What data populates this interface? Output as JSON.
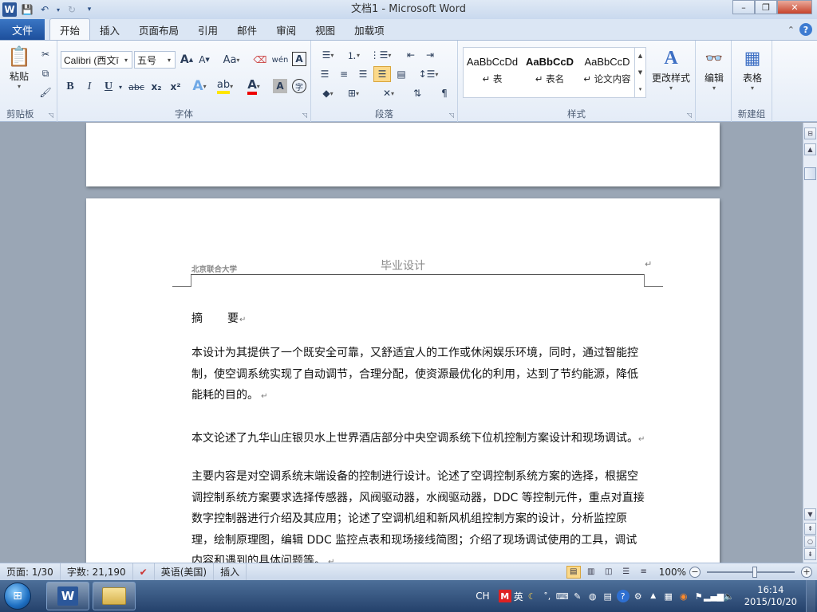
{
  "window": {
    "title": "文档1 - Microsoft Word",
    "minimize": "–",
    "restore": "❐",
    "close": "✕"
  },
  "tabs": {
    "file": "文件",
    "items": [
      "开始",
      "插入",
      "页面布局",
      "引用",
      "邮件",
      "审阅",
      "视图",
      "加载项"
    ],
    "active_index": 0
  },
  "ribbon": {
    "clipboard": {
      "label": "剪贴板",
      "paste": "粘贴"
    },
    "font": {
      "label": "字体",
      "font_name": "Calibri (西文ī",
      "font_size": "五号",
      "bold": "B",
      "italic": "I",
      "underline": "U",
      "strike": "abc",
      "subscript": "x₂",
      "superscript": "x²",
      "grow": "A",
      "shrink": "A",
      "change_case": "Aa"
    },
    "paragraph": {
      "label": "段落"
    },
    "styles": {
      "label": "样式",
      "items": [
        {
          "sample": "AaBbCcDd",
          "name": "↵ 表"
        },
        {
          "sample": "AaBbCcD",
          "name": "↵ 表名"
        },
        {
          "sample": "AaBbCcD",
          "name": "↵ 论文内容"
        }
      ],
      "change_styles": "更改样式"
    },
    "editing": {
      "label": "编辑"
    },
    "new_group": {
      "label": "新建组",
      "table": "表格"
    }
  },
  "document": {
    "header_left": "北京联合大学",
    "header_center": "毕业设计",
    "abstract_title": "摘　　要",
    "paragraphs": [
      "本设计为其提供了一个既安全可靠，又舒适宜人的工作或休闲娱乐环境，同时，通过智能控制，使空调系统实现了自动调节，合理分配，使资源最优化的利用，达到了节约能源，降低能耗的目的。",
      "本文论述了九华山庄银贝水上世界酒店部分中央空调系统下位机控制方案设计和现场调试。",
      "主要内容是对空调系统末端设备的控制进行设计。论述了空调控制系统方案的选择，根据空调控制系统方案要求选择传感器，风阀驱动器，水阀驱动器，DDC 等控制元件，重点对直接数字控制器进行介绍及其应用；论述了空调机组和新风机组控制方案的设计，分析监控原理，绘制原理图，编辑 DDC 监控点表和现场接线简图；介绍了现场调试使用的工具，调试内容和遇到的具体问题等。"
    ]
  },
  "statusbar": {
    "page": "页面: 1/30",
    "words": "字数: 21,190",
    "language": "英语(美国)",
    "mode": "插入",
    "zoom": "100%",
    "zoom_fraction": 0.55
  },
  "taskbar": {
    "ime_lang": "CH",
    "ime_mode": "英",
    "time": "16:14",
    "date": "2015/10/20"
  }
}
